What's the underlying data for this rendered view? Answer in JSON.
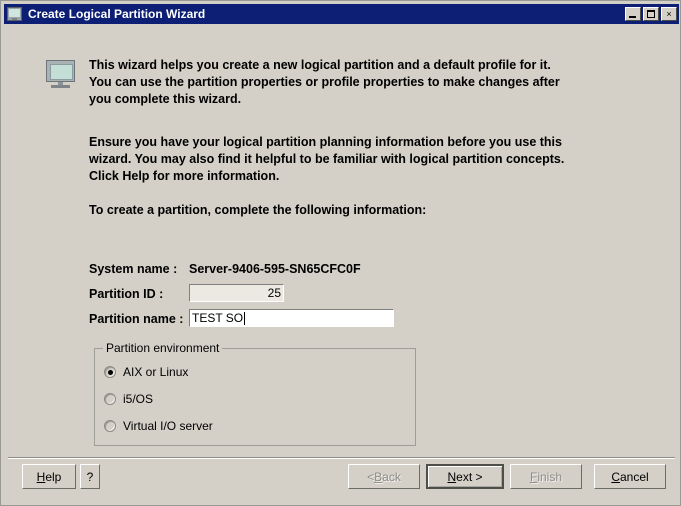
{
  "window": {
    "title": "Create Logical Partition Wizard",
    "title_icon": "monitor-icon",
    "controls": {
      "minimize_label": "_",
      "maximize_label": "□",
      "close_label": "×"
    },
    "colors": {
      "titlebar": "#0d1f74",
      "titlebar_text": "#ffffff",
      "face": "#d4d0c8",
      "field": "#ffffff",
      "field_readonly": "#ece9e2",
      "disabled_text": "#8d8d87"
    }
  },
  "content": {
    "wizard_icon": "monitor-icon",
    "paragraph_1": "This wizard helps you create a new logical partition and a default profile for it.  You can use the partition properties or profile properties to make changes after you complete this wizard.",
    "paragraph_2": "Ensure you have your logical partition planning information before you use this wizard.  You may also find it helpful to be familiar with logical partition concepts.  Click Help for more information.",
    "paragraph_3": "To create a partition, complete the following information:"
  },
  "form": {
    "system_name": {
      "label": "System name :",
      "value": "Server-9406-595-SN65CFC0F"
    },
    "partition_id": {
      "label": "Partition ID :",
      "value": "25",
      "placeholder": ""
    },
    "partition_name": {
      "label": "Partition name :",
      "value": "TEST SO",
      "placeholder": ""
    }
  },
  "partition_environment": {
    "legend": "Partition environment",
    "selected": "AIX or Linux",
    "options": [
      {
        "label": "AIX or Linux",
        "checked": true
      },
      {
        "label": "i5/OS",
        "checked": false
      },
      {
        "label": "Virtual I/O server",
        "checked": false
      }
    ]
  },
  "buttons": {
    "help": {
      "label": "Help",
      "mnemonic": "H",
      "before": "",
      "after": "elp",
      "disabled": false
    },
    "question": {
      "label": "?",
      "disabled": false
    },
    "back": {
      "label": "< Back",
      "mnemonic": "B",
      "before": "< ",
      "after": "ack",
      "disabled": true
    },
    "next": {
      "label": "Next >",
      "mnemonic": "N",
      "before": "",
      "after": "ext >",
      "disabled": false,
      "is_default": true
    },
    "finish": {
      "label": "Finish",
      "mnemonic": "F",
      "before": "",
      "after": "inish",
      "disabled": true
    },
    "cancel": {
      "label": "Cancel",
      "mnemonic": "C",
      "before": "",
      "after": "ancel",
      "disabled": false
    }
  }
}
